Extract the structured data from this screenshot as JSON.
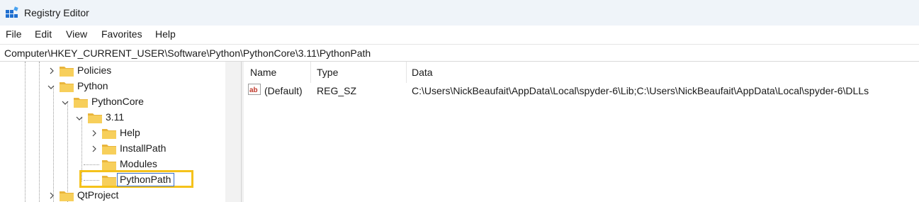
{
  "window": {
    "title": "Registry Editor"
  },
  "menu": [
    "File",
    "Edit",
    "View",
    "Favorites",
    "Help"
  ],
  "address": "Computer\\HKEY_CURRENT_USER\\Software\\Python\\PythonCore\\3.11\\PythonPath",
  "tree": [
    {
      "label": "Policies",
      "state": "collapsed"
    },
    {
      "label": "Python",
      "state": "expanded"
    },
    {
      "label": "PythonCore",
      "state": "expanded"
    },
    {
      "label": "3.11",
      "state": "expanded"
    },
    {
      "label": "Help",
      "state": "collapsed"
    },
    {
      "label": "InstallPath",
      "state": "collapsed"
    },
    {
      "label": "Modules",
      "state": "leaf"
    },
    {
      "label": "PythonPath",
      "state": "leaf-selected"
    },
    {
      "label": "QtProject",
      "state": "collapsed"
    }
  ],
  "columns": [
    "Name",
    "Type",
    "Data"
  ],
  "rows": [
    {
      "name": "(Default)",
      "type": "REG_SZ",
      "data": "C:\\Users\\NickBeaufait\\AppData\\Local\\spyder-6\\Lib;C:\\Users\\NickBeaufait\\AppData\\Local\\spyder-6\\DLLs",
      "icon": "string-value-icon"
    }
  ],
  "colors": {
    "highlight": "#f5c21b",
    "folder": "#f4c94a",
    "accent": "#1e88e5"
  }
}
